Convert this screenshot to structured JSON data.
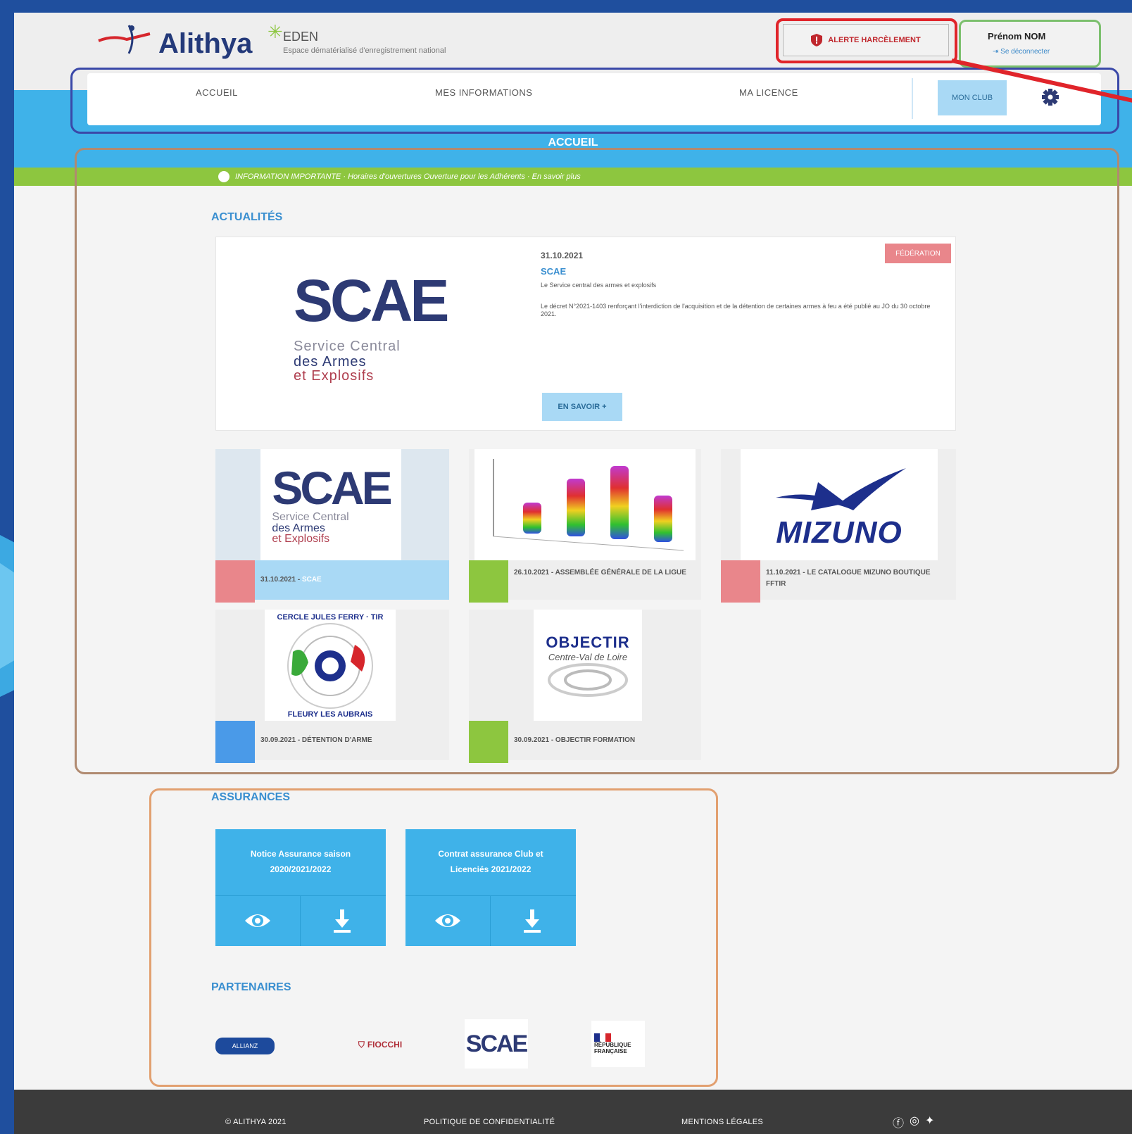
{
  "brand": {
    "logo_name": "Alithya",
    "app_name": "EDEN",
    "app_tagline": "Espace dématérialisé d'enregistrement national"
  },
  "header": {
    "alert_button": "ALERTE HARCÈLEMENT",
    "user_name": "Prénom NOM",
    "logout": "Se déconnecter"
  },
  "nav": {
    "items": [
      "ACCUEIL",
      "MES INFORMATIONS",
      "MA LICENCE"
    ],
    "club_button": "MON CLUB",
    "page_title": "ACCUEIL"
  },
  "info_bar": "INFORMATION IMPORTANTE · Horaires d'ouvertures Ouverture pour les Adhérents · En savoir plus",
  "news": {
    "section_title": "ACTUALITÉS",
    "featured": {
      "date": "31.10.2021",
      "badge": "FÉDÉRATION",
      "title": "SCAE",
      "subtitle": "Le Service central des armes et explosifs",
      "description": "Le décret N°2021-1403 renforçant l'interdiction de l'acquisition et de la détention de certaines armes à feu a été publié au JO du 30 octobre 2021.",
      "button": "EN SAVOIR +",
      "logo_text": "SCAE",
      "logo_lines": [
        "Service Central",
        "des Armes",
        "et Explosifs"
      ]
    },
    "tiles": [
      {
        "caption": "31.10.2021 - ",
        "tag": "SCAE",
        "color": "#e9868b"
      },
      {
        "caption": "26.10.2021 - ASSEMBLÉE GÉNÉRALE DE LA LIGUE",
        "color": "#8dc63f"
      },
      {
        "caption": "11.10.2021 - LE CATALOGUE MIZUNO BOUTIQUE FFTIR",
        "color": "#e9868b"
      },
      {
        "caption": "30.09.2021 - DÉTENTION D'ARME",
        "color": "#4a9ae8"
      },
      {
        "caption": "30.09.2021 - OBJECTIR FORMATION",
        "color": "#8dc63f"
      }
    ],
    "mizuno": "MIZUNO",
    "cercle_text": "CERCLE JULES FERRY · TIR",
    "cercle_bottom": "FLEURY LES AUBRAIS",
    "objectir": "OBJECTIR",
    "objectir_sub": "Centre-Val de Loire"
  },
  "insurance": {
    "section_title": "ASSURANCES",
    "cards": [
      {
        "title_line1": "Notice Assurance saison",
        "title_line2": "2020/2021/2022"
      },
      {
        "title_line1": "Contrat assurance Club et",
        "title_line2": "Licenciés 2021/2022"
      }
    ]
  },
  "partners": {
    "section_title": "PARTENAIRES",
    "items": [
      "ALLIANZ",
      "FIOCCHI",
      "SCAE",
      "RÉPUBLIQUE FRANÇAISE"
    ]
  },
  "footer": {
    "copyright": "ALITHYA 2021",
    "privacy": "POLITIQUE DE CONFIDENTIALITÉ",
    "legal": "MENTIONS LÉGALES"
  },
  "colors": {
    "primary": "#3fb2e9",
    "green": "#8dc63f",
    "alert": "#c0272d",
    "navy": "#1f4f9e"
  }
}
